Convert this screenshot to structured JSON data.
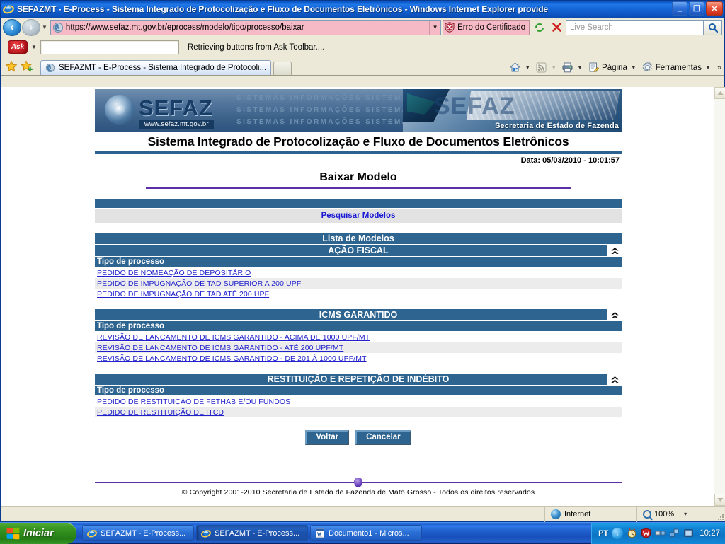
{
  "browser": {
    "title": "SEFAZMT - E-Process - Sistema Integrado de Protocolização e Fluxo de Documentos Eletrônicos - Windows Internet Explorer provide",
    "window_buttons": {
      "minimize": "_",
      "restore": "❐",
      "close": "✕"
    },
    "address": {
      "url": "https://www.sefaz.mt.gov.br/eprocess/modelo/tipo/processo/baixar",
      "cert_error_label": "Erro do Certificado",
      "refresh_glyph": "↻",
      "stop_glyph": "✕"
    },
    "search": {
      "placeholder": "Live Search",
      "go_glyph": "🔍"
    },
    "ask_toolbar": {
      "logo_label": "Ask",
      "input_value": "",
      "status": "Retrieving buttons from Ask Toolbar...."
    },
    "tab": {
      "label": "SEFAZMT - E-Process - Sistema Integrado de Protocoli..."
    },
    "command_bar": {
      "home_label": "",
      "feeds_label": "",
      "print_label": "",
      "page_label": "Página",
      "tools_label": "Ferramentas",
      "overflow": "»"
    },
    "status_bar": {
      "left": "",
      "zone": "Internet",
      "zoom": "100%",
      "zoom_caret": "▾"
    }
  },
  "page": {
    "banner": {
      "brand": "SEFAZ",
      "url": "www.sefaz.mt.gov.br",
      "ghost_text": "SISTEMAS   INFORMAÇÕES   SISTEMAS",
      "right_caption": "Secretaria de Estado de Fazenda",
      "right_ghost": "SEFAZ"
    },
    "system_name": "Sistema Integrado de Protocolização e Fluxo de Documentos Eletrônicos",
    "date_line": "Data: 05/03/2010 - 10:01:57",
    "title": "Baixar Modelo",
    "search_link": "Pesquisar Modelos",
    "list_header": "Lista de Modelos",
    "column_header": "Tipo de processo",
    "collapse_icon": "chevron-up-double",
    "sections": [
      {
        "name": "AÇÃO FISCAL",
        "items": [
          "PEDIDO DE NOMEAÇÃO DE DEPOSITÁRIO",
          "PEDIDO DE IMPUGNAÇÃO DE TAD SUPERIOR A 200 UPF",
          "PEDIDO DE IMPUGNAÇÃO DE TAD ATÉ 200 UPF"
        ]
      },
      {
        "name": "ICMS GARANTIDO",
        "items": [
          "REVISÃO DE LANCAMENTO DE ICMS GARANTIDO - ACIMA DE 1000 UPF/MT",
          "REVISÃO DE LANCAMENTO DE ICMS GARANTIDO - ATÉ 200 UPF/MT",
          "REVISÃO DE LANCAMENTO DE ICMS GARANTIDO - DE 201 À 1000 UPF/MT"
        ]
      },
      {
        "name": "RESTITUIÇÃO E REPETIÇÃO DE INDÉBITO",
        "items": [
          "PEDIDO DE RESTITUIÇÃO DE FETHAB E/OU FUNDOS",
          "PEDIDO DE RESTITUIÇÃO DE ITCD"
        ]
      }
    ],
    "buttons": {
      "back": "Voltar",
      "cancel": "Cancelar"
    },
    "copyright": "© Copyright 2001-2010 Secretaria de Estado de Fazenda de Mato Grosso - Todos os direitos reservados"
  },
  "taskbar": {
    "start_label": "Iniciar",
    "items": [
      {
        "label": "SEFAZMT - E-Process...",
        "active": false
      },
      {
        "label": "SEFAZMT - E-Process...",
        "active": true
      },
      {
        "label": "Documento1 - Micros...",
        "active": false
      }
    ],
    "tray": {
      "language": "PT",
      "chevron": "‹",
      "clock": "10:27"
    }
  },
  "colors": {
    "section_blue": "#2e6490",
    "link_blue": "#2222cc",
    "rule_purple": "#5b2fa8",
    "row_alt": "#ececec",
    "cert_pink": "#f6b9c6"
  }
}
